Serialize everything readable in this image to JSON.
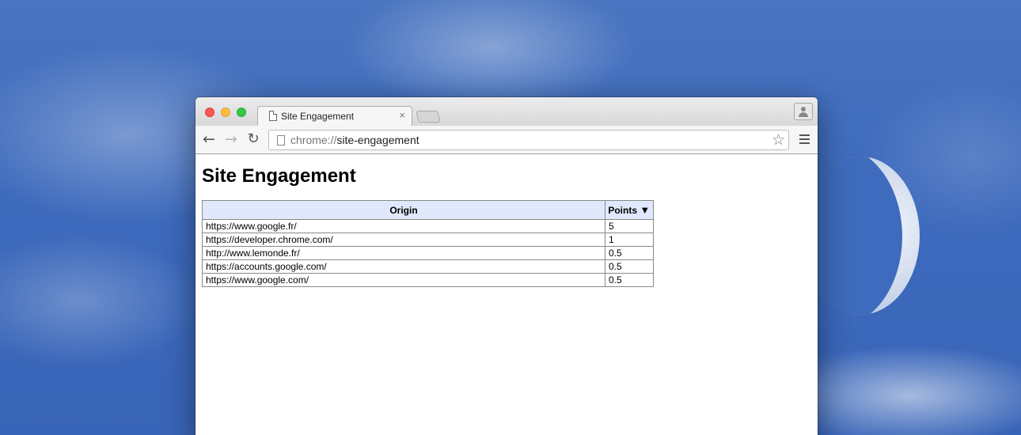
{
  "browser": {
    "tab_title": "Site Engagement",
    "tab_close": "×",
    "url_scheme": "chrome://",
    "url_rest": "site-engagement",
    "star": "☆"
  },
  "page": {
    "title": "Site Engagement",
    "table": {
      "headers": {
        "origin": "Origin",
        "points": "Points",
        "sort_indicator": "▼"
      },
      "rows": [
        {
          "origin": "https://www.google.fr/",
          "points": "5"
        },
        {
          "origin": "https://developer.chrome.com/",
          "points": "1"
        },
        {
          "origin": "http://www.lemonde.fr/",
          "points": "0.5"
        },
        {
          "origin": "https://accounts.google.com/",
          "points": "0.5"
        },
        {
          "origin": "https://www.google.com/",
          "points": "0.5"
        }
      ]
    }
  }
}
